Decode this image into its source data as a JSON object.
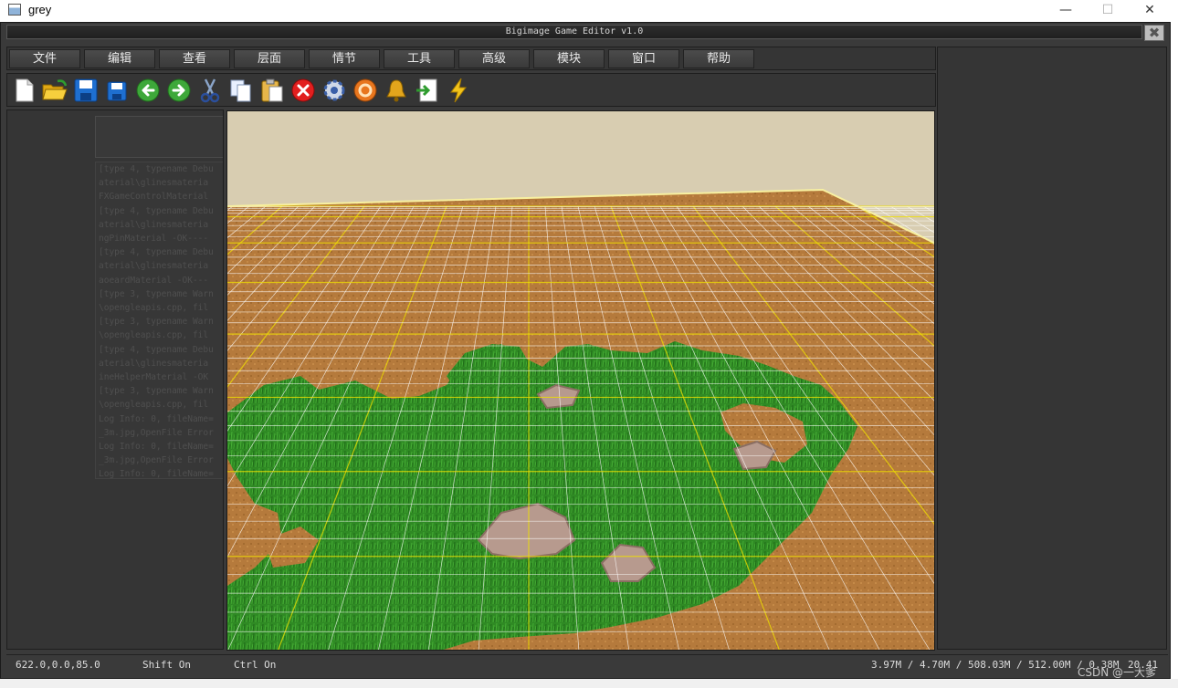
{
  "os_window": {
    "title": "grey",
    "minimize": "—",
    "maximize": "☐",
    "close": "✕"
  },
  "editor": {
    "title": "Bigimage Game Editor v1.0",
    "close": "✖"
  },
  "menu": {
    "items": [
      "文件",
      "编辑",
      "查看",
      "层面",
      "情节",
      "工具",
      "高级",
      "模块",
      "窗口",
      "帮助"
    ]
  },
  "toolbar": {
    "tools": [
      "new-file-icon",
      "open-folder-icon",
      "save-icon",
      "save-as-icon",
      "undo-arrow-icon",
      "redo-arrow-icon",
      "cut-icon",
      "copy-icon",
      "paste-icon",
      "delete-icon",
      "settings-gear-icon",
      "orange-circle-icon",
      "bell-icon",
      "export-icon",
      "lightning-icon"
    ]
  },
  "log": {
    "lines": [
      "[type 4, typename Debu",
      "aterial\\glinesmateria",
      "FXGameControlMaterial",
      "[type 4, typename Debu",
      "aterial\\glinesmateria",
      "ngPinMaterial -OK----",
      "[type 4, typename Debu",
      "aterial\\glinesmateria",
      "aoeardMaterial -OK---",
      "[type 3, typename Warn",
      "\\opengleapis.cpp, fil",
      "[type 3, typename Warn",
      "\\opengleapis.cpp, fil",
      "[type 4, typename Debu",
      "aterial\\glinesmateria",
      "ineHelperMaterial -OK",
      "[type 3, typename Warn",
      "\\opengleapis.cpp, fil",
      "Log Info: 0, fileName=",
      "_3m.jpg,OpenFile Error",
      "Log Info: 0, fileName=",
      "_3m.jpg,OpenFile Error",
      "Log Info: 0, fileName="
    ]
  },
  "status": {
    "coords": "622.0,0.0,85.0",
    "shift": "Shift On",
    "ctrl": "Ctrl On",
    "memory": "3.97M / 4.70M / 508.03M / 512.00M / 0.38M",
    "fps": "20.41"
  },
  "watermark": "CSDN @一大爹"
}
